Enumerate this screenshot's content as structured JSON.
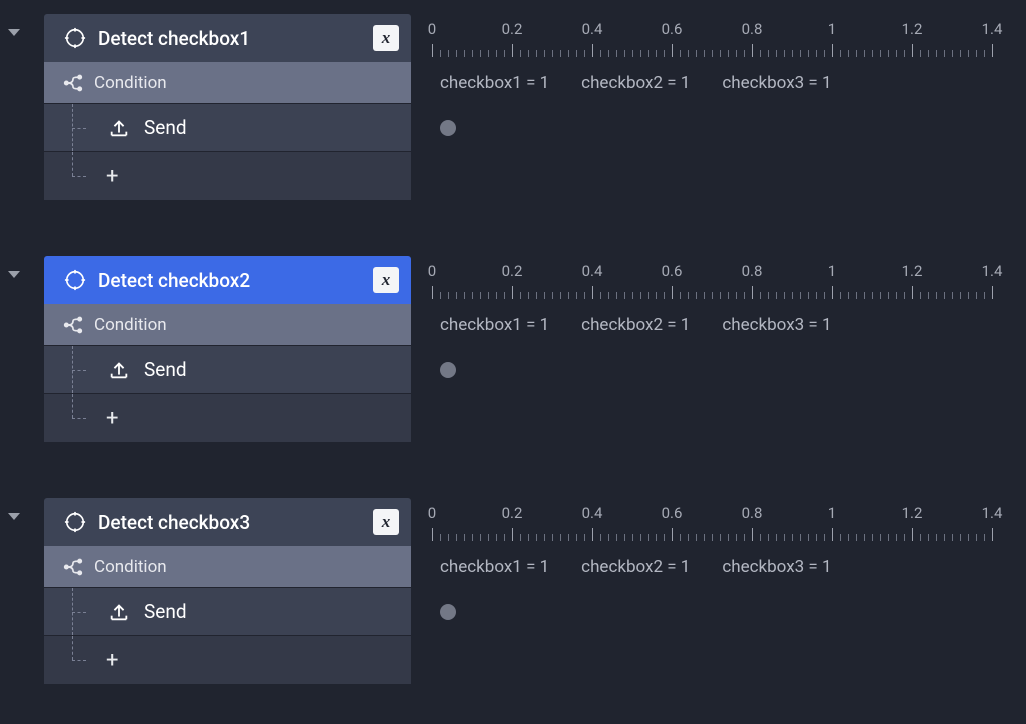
{
  "ruler_ticks": [
    "0",
    "0.2",
    "0.4",
    "0.6",
    "0.8",
    "1",
    "1.2",
    "1.4"
  ],
  "tracks": [
    {
      "id": "t1",
      "title": "Detect checkbox1",
      "selected": false,
      "var_badge": "x",
      "condition_label": "Condition",
      "conditions": [
        "checkbox1 = 1",
        "checkbox2 = 1",
        "checkbox3 = 1"
      ],
      "child_label": "Send",
      "add_label": "+"
    },
    {
      "id": "t2",
      "title": "Detect checkbox2",
      "selected": true,
      "var_badge": "x",
      "condition_label": "Condition",
      "conditions": [
        "checkbox1 = 1",
        "checkbox2 = 1",
        "checkbox3 = 1"
      ],
      "child_label": "Send",
      "add_label": "+"
    },
    {
      "id": "t3",
      "title": "Detect checkbox3",
      "selected": false,
      "var_badge": "x",
      "condition_label": "Condition",
      "conditions": [
        "checkbox1 = 1",
        "checkbox2 = 1",
        "checkbox3 = 1"
      ],
      "child_label": "Send",
      "add_label": "+"
    }
  ]
}
